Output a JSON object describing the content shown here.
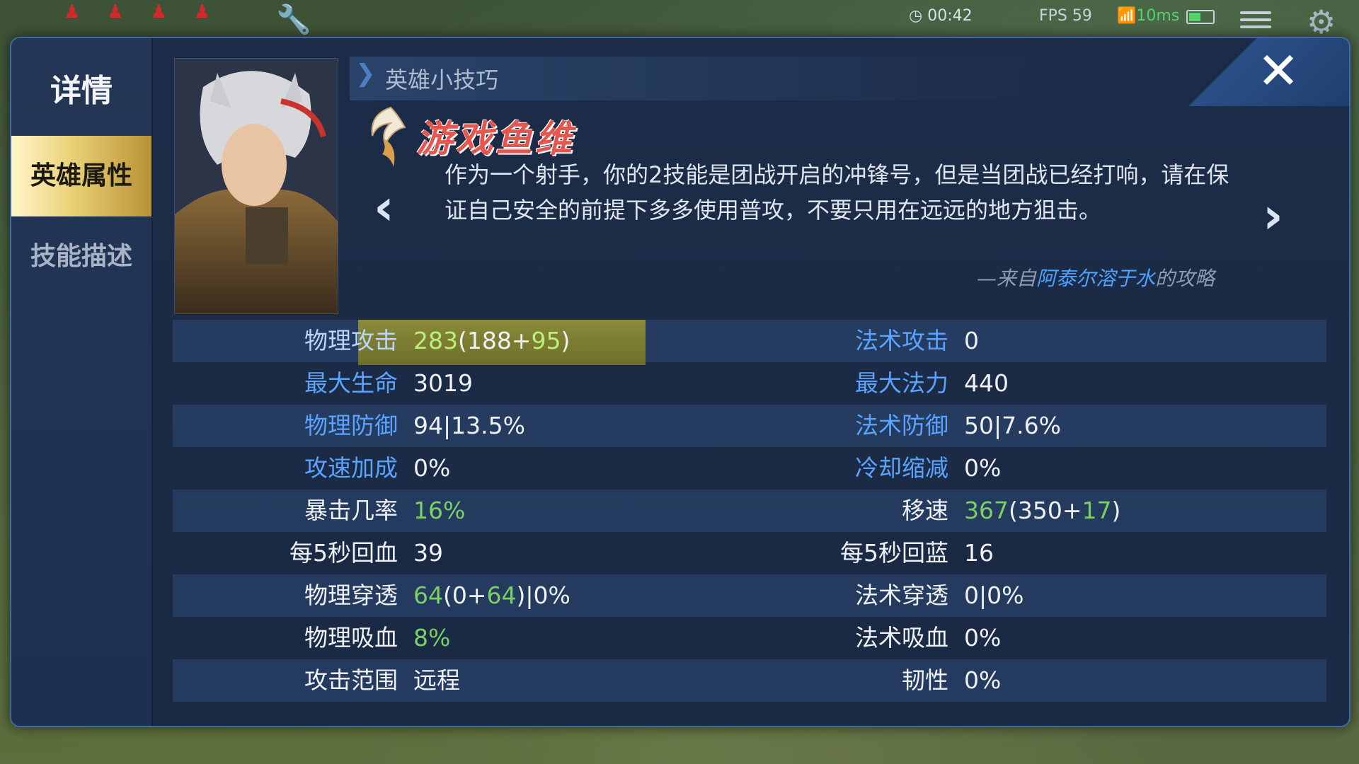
{
  "hud": {
    "clock": "00:42",
    "fps": "FPS 59",
    "ping": "10ms"
  },
  "dialog": {
    "title": "详情",
    "tabs": [
      {
        "label": "英雄属性",
        "active": true
      },
      {
        "label": "技能描述",
        "active": false
      }
    ],
    "tips": {
      "header": "英雄小技巧",
      "brand": "游戏鱼维",
      "text": "作为一个射手，你的2技能是团战开启的冲锋号，但是当团战已经打响，请在保证自己安全的前提下多多使用普攻，不要只用在远远的地方狙击。",
      "credit_prefix": "—来自",
      "credit_author": "阿泰尔溶于水",
      "credit_suffix": "的攻略"
    },
    "stats": [
      {
        "l_label": "物理攻击",
        "l_parts": [
          [
            "283",
            "green"
          ],
          [
            "(188+",
            "white"
          ],
          [
            "95",
            "green"
          ],
          [
            ")",
            "white"
          ]
        ],
        "r_label": "法术攻击",
        "r_parts": [
          [
            "0",
            "white"
          ]
        ],
        "l_blue": true,
        "r_blue": true,
        "highlight": true
      },
      {
        "l_label": "最大生命",
        "l_parts": [
          [
            "3019",
            "white"
          ]
        ],
        "r_label": "最大法力",
        "r_parts": [
          [
            "440",
            "white"
          ]
        ],
        "l_blue": true,
        "r_blue": true
      },
      {
        "l_label": "物理防御",
        "l_parts": [
          [
            "94|13.5%",
            "white"
          ]
        ],
        "r_label": "法术防御",
        "r_parts": [
          [
            "50|7.6%",
            "white"
          ]
        ],
        "l_blue": true,
        "r_blue": true
      },
      {
        "l_label": "攻速加成",
        "l_parts": [
          [
            "0%",
            "white"
          ]
        ],
        "r_label": "冷却缩减",
        "r_parts": [
          [
            "0%",
            "white"
          ]
        ],
        "l_blue": true,
        "r_blue": true
      },
      {
        "l_label": "暴击几率",
        "l_parts": [
          [
            "16%",
            "green"
          ]
        ],
        "r_label": "移速",
        "r_parts": [
          [
            "367",
            "green"
          ],
          [
            "(350+",
            "white"
          ],
          [
            "17",
            "green"
          ],
          [
            ")",
            "white"
          ]
        ],
        "l_blue": false,
        "r_blue": false
      },
      {
        "l_label": "每5秒回血",
        "l_parts": [
          [
            "39",
            "white"
          ]
        ],
        "r_label": "每5秒回蓝",
        "r_parts": [
          [
            "16",
            "white"
          ]
        ],
        "l_blue": false,
        "r_blue": false
      },
      {
        "l_label": "物理穿透",
        "l_parts": [
          [
            "64",
            "green"
          ],
          [
            "(0+",
            "white"
          ],
          [
            "64",
            "green"
          ],
          [
            ")|0%",
            "white"
          ]
        ],
        "r_label": "法术穿透",
        "r_parts": [
          [
            "0|0%",
            "white"
          ]
        ],
        "l_blue": false,
        "r_blue": false
      },
      {
        "l_label": "物理吸血",
        "l_parts": [
          [
            "8%",
            "green"
          ]
        ],
        "r_label": "法术吸血",
        "r_parts": [
          [
            "0%",
            "white"
          ]
        ],
        "l_blue": false,
        "r_blue": false
      },
      {
        "l_label": "攻击范围",
        "l_parts": [
          [
            "远程",
            "white"
          ]
        ],
        "r_label": "韧性",
        "r_parts": [
          [
            "0%",
            "white"
          ]
        ],
        "l_blue": false,
        "r_blue": false
      }
    ]
  },
  "icons": {
    "close": "close-icon",
    "prev": "chevron-left-icon",
    "next": "chevron-right-icon",
    "settings": "gear-icon",
    "menu": "menu-icon"
  },
  "colors": {
    "accent_blue": "#5aa4ff",
    "stat_green": "#7ad065",
    "tab_gold": "#e9cf74",
    "brand_red": "#e4574f"
  }
}
